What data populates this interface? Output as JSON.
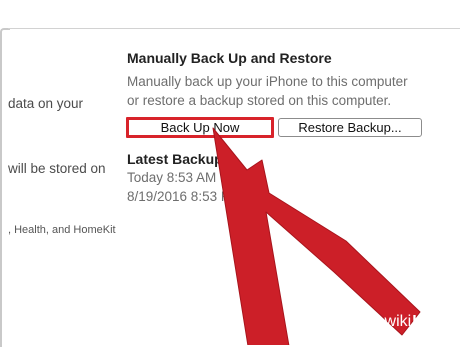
{
  "left_column": {
    "line1": "data on your",
    "line2": "will be stored on",
    "line3": ", Health, and HomeKit"
  },
  "manual_backup": {
    "title": "Manually Back Up and Restore",
    "description_line1": "Manually back up your iPhone to this computer",
    "description_line2": "or restore a backup stored on this computer.",
    "back_up_now_label": "Back Up Now",
    "restore_backup_label": "Restore Backup..."
  },
  "latest_backups": {
    "title": "Latest Backups",
    "entries": [
      "Today 8:53 AM t",
      "8/19/2016 8:53 P"
    ]
  },
  "annotation": {
    "arrow_color": "#cc1f28",
    "highlight_color": "#d8232a"
  },
  "watermark": {
    "wiki": "wiki",
    "how": "How"
  }
}
